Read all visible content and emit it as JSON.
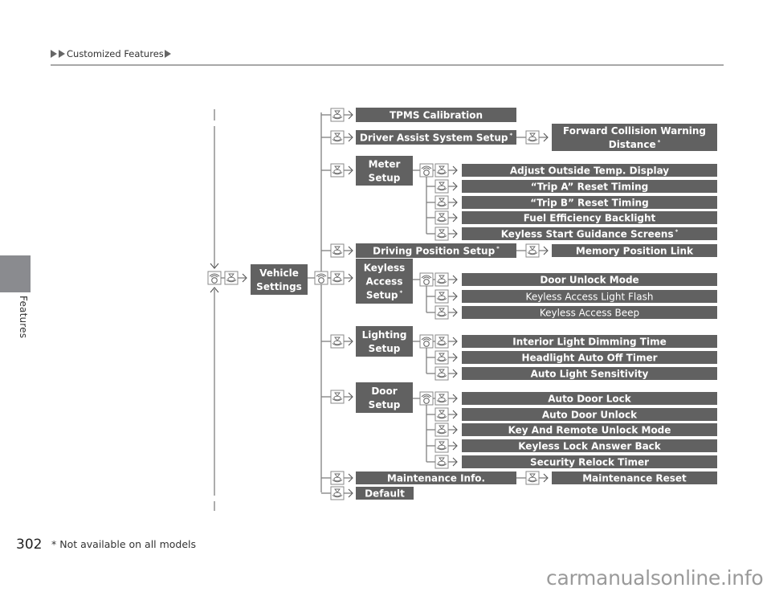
{
  "header": {
    "breadcrumb": "Customized Features"
  },
  "side": {
    "tab_label": "Features"
  },
  "footer": {
    "page_number": "302",
    "footnote": "* Not available on all models",
    "watermark": "carmanualsonline.info"
  },
  "colors": {
    "box": "#616161",
    "line": "#808080",
    "tab": "#8a8b8f"
  },
  "tree": {
    "root": {
      "label_line1": "Vehicle",
      "label_line2": "Settings"
    },
    "level1": [
      {
        "id": "tpms",
        "label": "TPMS Calibration"
      },
      {
        "id": "driver-assist",
        "label": "Driver Assist System Setup",
        "asterisk": true
      },
      {
        "id": "meter",
        "label_line1": "Meter",
        "label_line2": "Setup"
      },
      {
        "id": "driving-position",
        "label": "Driving Position Setup",
        "asterisk": true
      },
      {
        "id": "keyless",
        "label_line1": "Keyless",
        "label_line2": "Access",
        "label_line3": "Setup",
        "asterisk": true
      },
      {
        "id": "lighting",
        "label_line1": "Lighting",
        "label_line2": "Setup"
      },
      {
        "id": "door",
        "label_line1": "Door",
        "label_line2": "Setup"
      },
      {
        "id": "maintenance",
        "label": "Maintenance Info."
      },
      {
        "id": "default",
        "label": "Default"
      }
    ],
    "driver_assist_children": [
      {
        "label_line1": "Forward Collision Warning",
        "label_line2": "Distance",
        "asterisk": true
      }
    ],
    "meter_children": [
      {
        "label": "Adjust Outside Temp. Display"
      },
      {
        "label": "“Trip A” Reset Timing"
      },
      {
        "label": "“Trip B” Reset Timing"
      },
      {
        "label": "Fuel Efficiency Backlight"
      },
      {
        "label": "Keyless Start Guidance Screens",
        "asterisk": true
      }
    ],
    "driving_position_children": [
      {
        "label": "Memory Position Link"
      }
    ],
    "keyless_children": [
      {
        "label": "Door Unlock Mode"
      },
      {
        "label": "Keyless Access Light Flash"
      },
      {
        "label": "Keyless Access Beep"
      }
    ],
    "lighting_children": [
      {
        "label": "Interior Light Dimming Time"
      },
      {
        "label": "Headlight Auto Off Timer"
      },
      {
        "label": "Auto Light Sensitivity"
      }
    ],
    "door_children": [
      {
        "label": "Auto Door Lock"
      },
      {
        "label": "Auto Door Unlock"
      },
      {
        "label": "Key And Remote Unlock Mode"
      },
      {
        "label": "Keyless Lock Answer Back"
      },
      {
        "label": "Security Relock Timer"
      }
    ],
    "maintenance_children": [
      {
        "label": "Maintenance Reset"
      }
    ],
    "asterisk_glyph": "*",
    "icons": {
      "press": "selector-knob-press-icon",
      "rotate": "selector-knob-rotate-icon",
      "arrow": "arrow-right-icon"
    }
  }
}
